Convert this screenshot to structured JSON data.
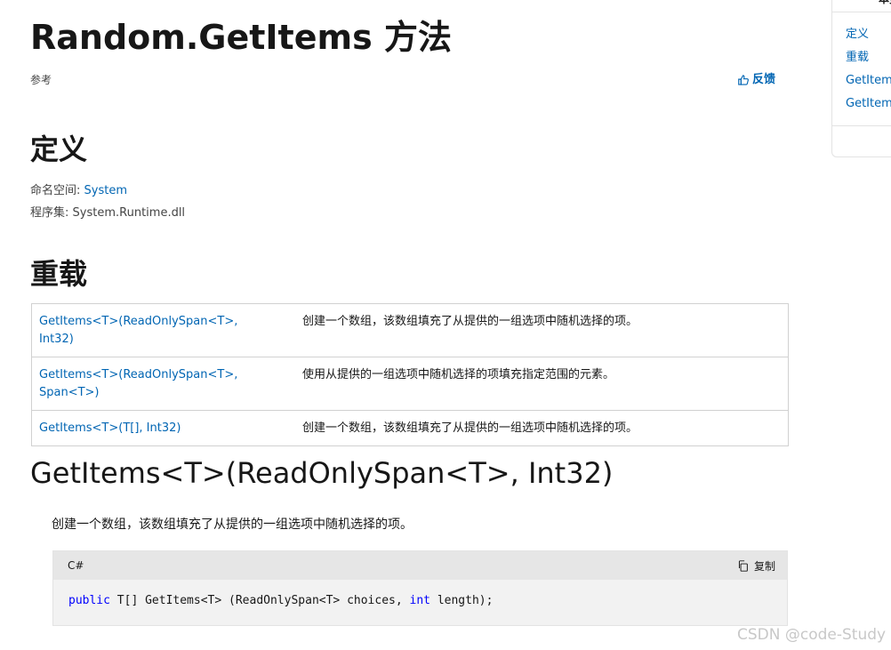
{
  "page": {
    "title": "Random.GetItems 方法",
    "reference_label": "参考",
    "feedback_label": "反馈"
  },
  "definition": {
    "heading": "定义",
    "namespace_label": "命名空间:",
    "namespace_value": "System",
    "assembly_label": "程序集:",
    "assembly_value": "System.Runtime.dll"
  },
  "overloads": {
    "heading": "重载",
    "rows": [
      {
        "signature": "GetItems<T>(ReadOnlySpan<T>, Int32)",
        "description": "创建一个数组，该数组填充了从提供的一组选项中随机选择的项。"
      },
      {
        "signature": "GetItems<T>(ReadOnlySpan<T>, Span<T>)",
        "description": "使用从提供的一组选项中随机选择的项填充指定范围的元素。"
      },
      {
        "signature": "GetItems<T>(T[], Int32)",
        "description": "创建一个数组，该数组填充了从提供的一组选项中随机选择的项。"
      }
    ]
  },
  "section": {
    "heading": "GetItems<T>(ReadOnlySpan<T>, Int32)",
    "description": "创建一个数组，该数组填充了从提供的一组选项中随机选择的项。"
  },
  "code_block": {
    "language": "C#",
    "copy_label": "复制",
    "tokens": {
      "kw_public": "public",
      "part1": " T[] GetItems<T> (ReadOnlySpan<T> choices, ",
      "kw_int": "int",
      "part2": " length);"
    }
  },
  "toc": {
    "header": "本页",
    "items": [
      "定义",
      "重载",
      "GetItems",
      "GetItems"
    ]
  },
  "watermark": "CSDN @code-Study",
  "colors": {
    "link": "#0065b3",
    "keyword": "#0101fd",
    "code_bg": "#f2f2f2",
    "code_header_bg": "#e6e6e6"
  }
}
